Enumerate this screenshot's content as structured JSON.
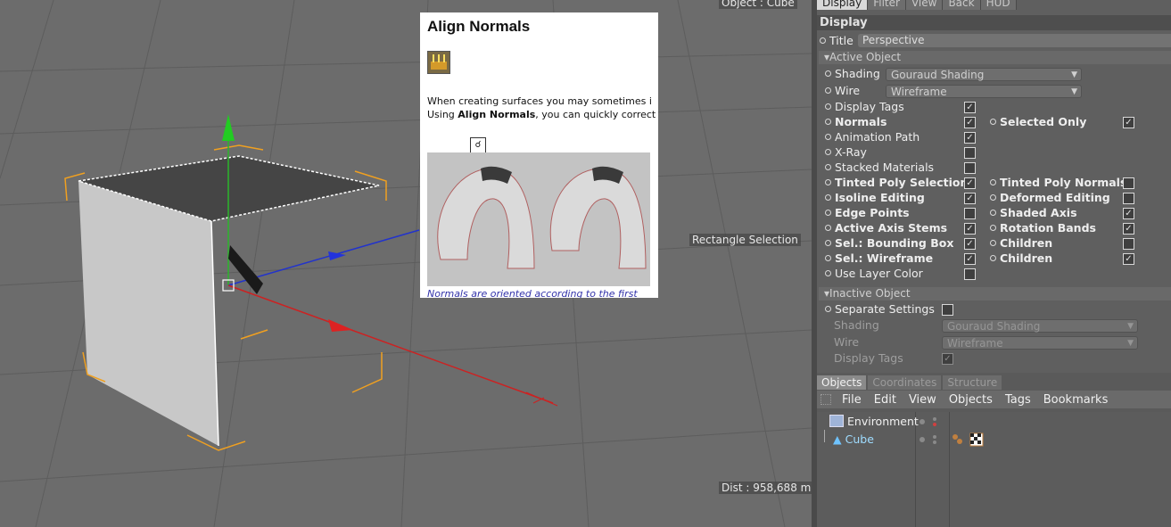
{
  "viewport": {
    "object_label": "Object : Cube",
    "rect_selection": "Rectangle Selection",
    "distance": "Dist : 958,688 m"
  },
  "help": {
    "title": "Align Normals",
    "text_line1": "When creating surfaces you may sometimes i",
    "text_line2_pre": "Using ",
    "text_line2_bold": "Align Normals",
    "text_line2_post": ", you can quickly correct th",
    "caption": "Normals are oriented according to the first"
  },
  "attributes": {
    "tabs": [
      "Display",
      "Filter",
      "View",
      "Back",
      "HUD"
    ],
    "section": "Display",
    "title_label": "Title",
    "title_value": "Perspective",
    "active_object_head": "Active Object",
    "shading_label": "Shading",
    "shading_value": "Gouraud Shading",
    "wire_label": "Wire",
    "wire_value": "Wireframe",
    "display_tags": "Display Tags",
    "normals": "Normals",
    "selected_only": "Selected Only",
    "animation_path": "Animation Path",
    "xray": "X-Ray",
    "stacked_materials": "Stacked Materials",
    "tinted_poly_selection": "Tinted Poly Selection",
    "tinted_poly_normals": "Tinted Poly Normals",
    "isoline_editing": "Isoline Editing",
    "deformed_editing": "Deformed Editing",
    "edge_points": "Edge Points",
    "shaded_axis": "Shaded Axis",
    "active_axis_stems": "Active Axis Stems",
    "rotation_bands": "Rotation Bands",
    "sel_bounding_box": "Sel.: Bounding Box",
    "children1": "Children",
    "sel_wireframe": "Sel.: Wireframe",
    "children2": "Children",
    "use_layer_color": "Use Layer Color",
    "inactive_object_head": "Inactive Object",
    "separate_settings": "Separate Settings",
    "in_shading_label": "Shading",
    "in_shading_value": "Gouraud Shading",
    "in_wire_label": "Wire",
    "in_wire_value": "Wireframe",
    "in_display_tags": "Display Tags"
  },
  "object_manager": {
    "tabs": [
      "Objects",
      "Coordinates",
      "Structure"
    ],
    "menu": [
      "File",
      "Edit",
      "View",
      "Objects",
      "Tags",
      "Bookmarks"
    ],
    "items": [
      "Environment",
      "Cube"
    ]
  }
}
